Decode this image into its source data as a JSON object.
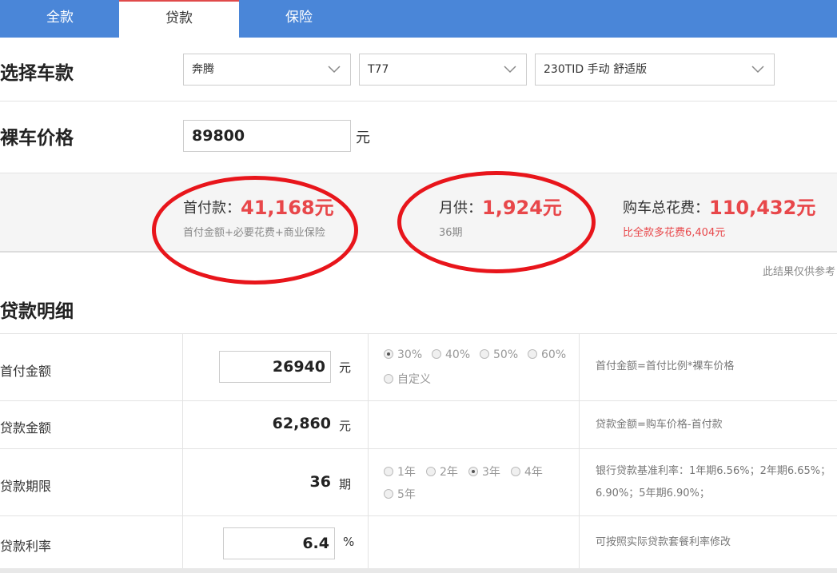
{
  "tabs": [
    {
      "label": "全款",
      "active": false
    },
    {
      "label": "贷款",
      "active": true
    },
    {
      "label": "保险",
      "active": false
    }
  ],
  "select_car": {
    "label": "选择车款",
    "brand": "奔腾",
    "series": "T77",
    "model": "230TID 手动 舒适版"
  },
  "bare_price": {
    "label": "裸车价格",
    "value": "89800",
    "unit": "元"
  },
  "summary": {
    "down_payment": {
      "label": "首付款：",
      "value": "41,168元",
      "note": "首付金额+必要花费+商业保险"
    },
    "monthly": {
      "label": "月供：",
      "value": "1,924元",
      "note": "36期"
    },
    "total": {
      "label": "购车总花费：",
      "value": "110,432元",
      "note": "比全款多花费6,404元"
    },
    "disclaimer": "此结果仅供参考"
  },
  "detail": {
    "title": "贷款明细",
    "rows": {
      "down": {
        "label": "首付金额",
        "value": "26940",
        "unit": "元",
        "options": [
          "30%",
          "40%",
          "50%",
          "60%",
          "自定义"
        ],
        "selected": "30%",
        "note": "首付金额=首付比例*裸车价格"
      },
      "loan": {
        "label": "贷款金额",
        "value": "62,860",
        "unit": "元",
        "note": "贷款金额=购车价格-首付款"
      },
      "term": {
        "label": "贷款期限",
        "value": "36",
        "unit": "期",
        "options": [
          "1年",
          "2年",
          "3年",
          "4年",
          "5年"
        ],
        "selected": "3年",
        "note_line1": "银行贷款基准利率：1年期6.56%；2年期6.65%；",
        "note_line2": "6.90%；5年期6.90%；"
      },
      "rate": {
        "label": "贷款利率",
        "value": "6.4",
        "unit": "%",
        "note": "可按照实际贷款套餐利率修改"
      }
    }
  },
  "colors": {
    "accent": "#4a86d8",
    "highlight": "#e8474a",
    "annotation": "#e8151b"
  }
}
